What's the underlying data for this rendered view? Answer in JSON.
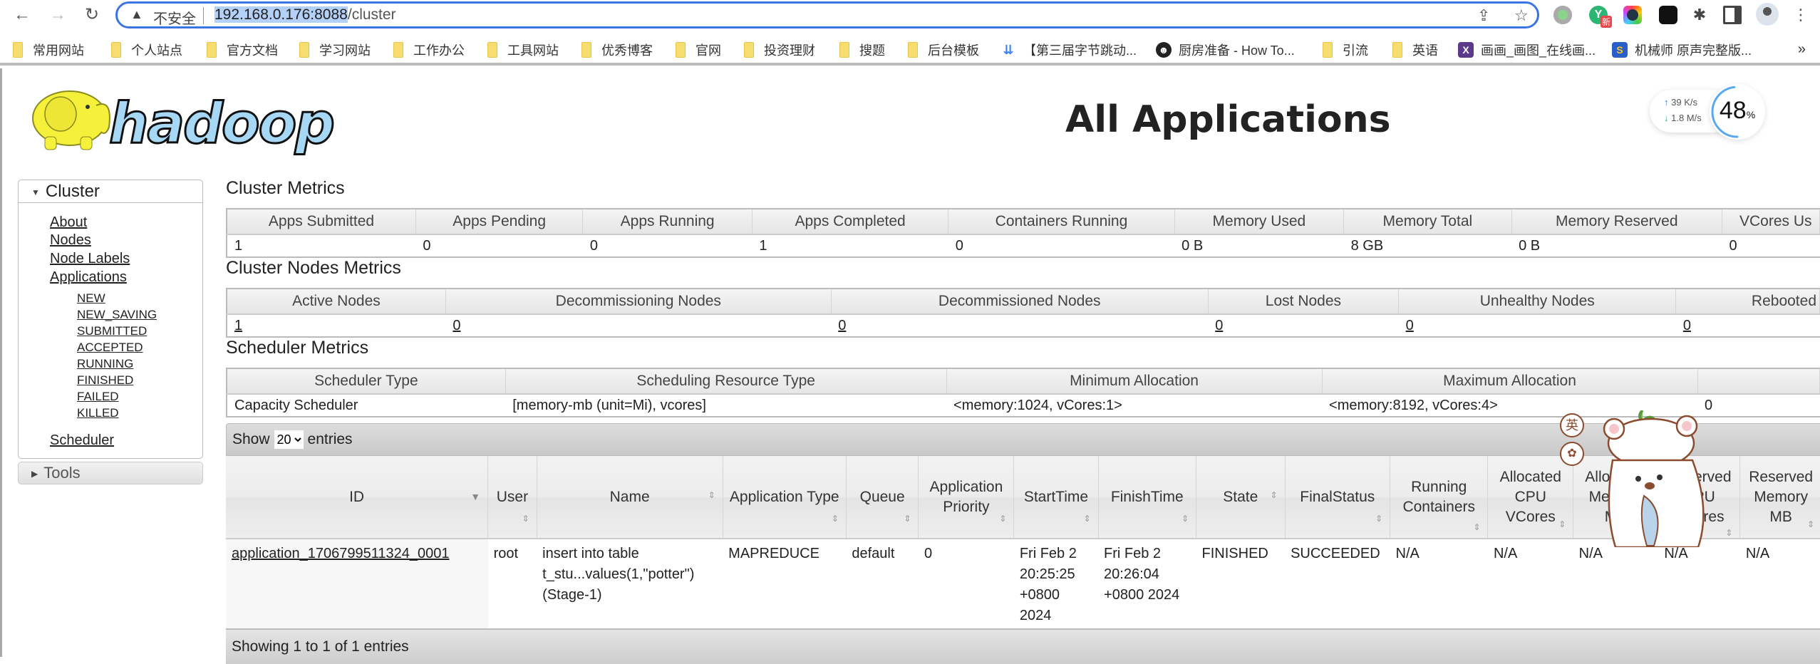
{
  "browser": {
    "nav": {
      "back_icon": "←",
      "forward_icon": "→",
      "reload_icon": "↻"
    },
    "omnibox": {
      "security_icon": "▲",
      "security_label": "不安全",
      "url_host": "192.168.0.176:8088",
      "url_path": "/cluster"
    },
    "omnibox_icons": {
      "share_icon": "⇪",
      "star_icon": "☆"
    },
    "extension_badge": "新",
    "bookmarks": [
      {
        "label": "常用网站",
        "type": "folder"
      },
      {
        "label": "个人站点",
        "type": "folder"
      },
      {
        "label": "官方文档",
        "type": "folder"
      },
      {
        "label": "学习网站",
        "type": "folder"
      },
      {
        "label": "工作办公",
        "type": "folder"
      },
      {
        "label": "工具网站",
        "type": "folder"
      },
      {
        "label": "优秀博客",
        "type": "folder"
      },
      {
        "label": "官网",
        "type": "folder"
      },
      {
        "label": "投资理财",
        "type": "folder"
      },
      {
        "label": "搜题",
        "type": "folder"
      },
      {
        "label": "后台模板",
        "type": "folder"
      },
      {
        "label": "【第三届字节跳动...",
        "type": "link"
      },
      {
        "label": "厨房准备 - How To...",
        "type": "link"
      },
      {
        "label": "引流",
        "type": "folder"
      },
      {
        "label": "英语",
        "type": "folder"
      },
      {
        "label": "画画_画图_在线画...",
        "type": "link"
      },
      {
        "label": "机械师 原声完整版...",
        "type": "link"
      }
    ],
    "bookmarks_more": "»"
  },
  "network_widget": {
    "upload": "39  K/s",
    "download": "1.8  M/s",
    "percent": "48",
    "percent_unit": "%",
    "percent_value": 48
  },
  "header": {
    "logo_text": "hadoop",
    "title": "All Applications"
  },
  "sidebar": {
    "cluster_label": "Cluster",
    "cluster_links": [
      "About",
      "Nodes",
      "Node Labels",
      "Applications"
    ],
    "app_states": [
      "NEW",
      "NEW_SAVING",
      "SUBMITTED",
      "ACCEPTED",
      "RUNNING",
      "FINISHED",
      "FAILED",
      "KILLED"
    ],
    "scheduler_link": "Scheduler",
    "tools_label": "Tools"
  },
  "cluster_metrics": {
    "title": "Cluster Metrics",
    "headers": [
      "Apps Submitted",
      "Apps Pending",
      "Apps Running",
      "Apps Completed",
      "Containers Running",
      "Memory Used",
      "Memory Total",
      "Memory Reserved",
      "VCores Us"
    ],
    "values": [
      "1",
      "0",
      "0",
      "1",
      "0",
      "0 B",
      "8 GB",
      "0 B",
      "0"
    ]
  },
  "cluster_nodes_metrics": {
    "title": "Cluster Nodes Metrics",
    "headers": [
      "Active Nodes",
      "Decommissioning Nodes",
      "Decommissioned Nodes",
      "Lost Nodes",
      "Unhealthy Nodes",
      "Rebooted"
    ],
    "values": [
      "1",
      "0",
      "0",
      "0",
      "0",
      "0"
    ]
  },
  "scheduler_metrics": {
    "title": "Scheduler Metrics",
    "headers": [
      "Scheduler Type",
      "Scheduling Resource Type",
      "Minimum Allocation",
      "Maximum Allocation",
      ""
    ],
    "values": [
      "Capacity Scheduler",
      "[memory-mb (unit=Mi), vcores]",
      "<memory:1024, vCores:1>",
      "<memory:8192, vCores:4>",
      "0"
    ]
  },
  "apps_table": {
    "show_label": "Show",
    "page_size": "20",
    "entries_label": "entries",
    "columns": [
      "ID",
      "User",
      "Name",
      "Application Type",
      "Queue",
      "Application Priority",
      "StartTime",
      "FinishTime",
      "State",
      "FinalStatus",
      "Running Containers",
      "Allocated CPU VCores",
      "Allocated Memory MB",
      "Reserved CPU VCores",
      "Reserved Memory MB"
    ],
    "rows": [
      {
        "id": "application_1706799511324_0001",
        "user": "root",
        "name": "insert into table t_stu...values(1,\"potter\") (Stage-1)",
        "type": "MAPREDUCE",
        "queue": "default",
        "priority": "0",
        "start": "Fri Feb 2 20:25:25 +0800 2024",
        "finish": "Fri Feb 2 20:26:04 +0800 2024",
        "state": "FINISHED",
        "final_status": "SUCCEEDED",
        "running_containers": "N/A",
        "alloc_vcores": "N/A",
        "alloc_mem": "N/A",
        "reserved_vcores": "N/A",
        "reserved_mem": "N/A"
      }
    ],
    "footer": "Showing 1 to 1 of 1 entries"
  },
  "overlay": {
    "ime_lang": "英",
    "ime_icon": "✿"
  }
}
